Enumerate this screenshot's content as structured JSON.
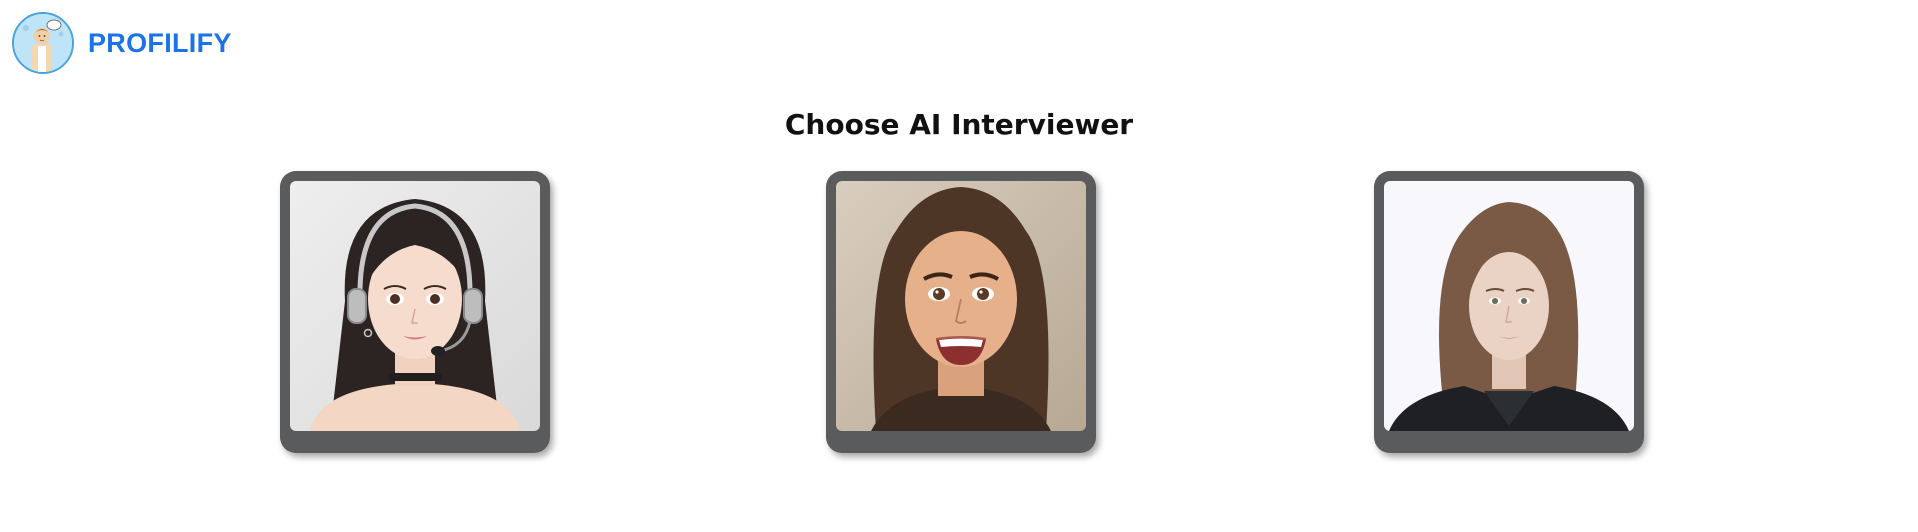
{
  "brand": {
    "name": "PROFILIFY",
    "logo_icon": "cartoon-man-logo-icon"
  },
  "page": {
    "title": "Choose AI Interviewer"
  },
  "interviewers": [
    {
      "icon": "interviewer-avatar-headset-icon",
      "description": "Animated woman with dark hair wearing a headset"
    },
    {
      "icon": "interviewer-avatar-smiling-icon",
      "description": "Animated smiling woman with brown hair"
    },
    {
      "icon": "interviewer-avatar-realistic-icon",
      "description": "Realistic woman with long brown hair"
    }
  ],
  "colors": {
    "brand_blue": "#1a73e8",
    "card_frame": "#5a5b5d",
    "title_text": "#111111"
  }
}
